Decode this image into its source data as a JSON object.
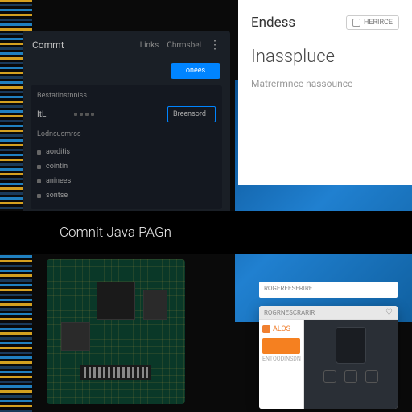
{
  "dark_panel": {
    "title": "Commt",
    "header_items": [
      "Links",
      "Chrmsbel"
    ],
    "button_label": "onees",
    "inner_title": "Bestatinstnniss",
    "row_label": "ItL",
    "highlight_text": "Breensord",
    "section_label": "Lodnsusmrss",
    "list_items": [
      "aorditis",
      "cointin",
      "aninees",
      "sontse"
    ]
  },
  "white_panel": {
    "brand": "Endess",
    "tag_label": "HERIRCE",
    "title": "Inasspluce",
    "subtitle": "Matrermnce nassounce"
  },
  "black_bar": {
    "text": "Comnit Java PAGn"
  },
  "mini_window": {
    "header_text": "ROGRNESCRARIR",
    "badge_label": "ALOS",
    "side_label": "ENTOODINSDN"
  },
  "label_strip": {
    "text": "ROGEREESERIRE"
  }
}
